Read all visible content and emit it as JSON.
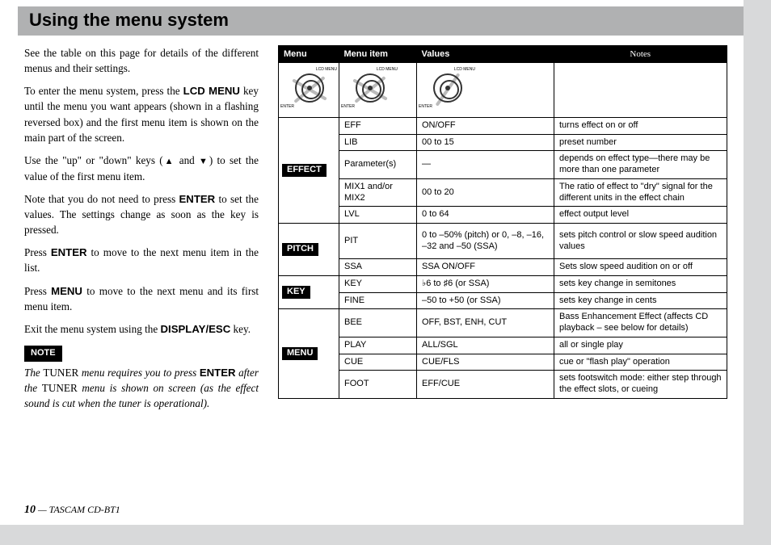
{
  "title": "Using the menu system",
  "footer": {
    "page": "10",
    "sep": " — ",
    "product": "TASCAM CD-BT1"
  },
  "body": {
    "p1": "See the table on this page for details of the different menus and their settings.",
    "p2a": "To enter the menu system, press the ",
    "p2b": "LCD MENU",
    "p2c": " key until the menu you want appears (shown in a flashing reversed box) and the first menu item is shown on the main part of the screen.",
    "p3a": "Use the \"up\" or \"down\" keys (",
    "p3b": "▲",
    "p3c": " and ",
    "p3d": "▼",
    "p3e": ") to set the value of the first menu item.",
    "p4a": "Note that you do not need to press ",
    "p4b": "ENTER",
    "p4c": " to set the values. The settings change as soon as the key is pressed.",
    "p5a": "Press ",
    "p5b": "ENTER",
    "p5c": " to move to the next menu item in the list.",
    "p6a": "Press ",
    "p6b": "MENU",
    "p6c": " to move to the next menu and its first menu item.",
    "p7a": "Exit the menu system using the ",
    "p7b": "DISPLAY/ESC",
    "p7c": " key.",
    "noteLabel": "NOTE",
    "note_a": "The ",
    "note_b": "TUNER",
    "note_c": " menu requires you to press ",
    "note_d": "ENTER",
    "note_e": " after the ",
    "note_f": "TUNER",
    "note_g": " menu is shown on screen (as the effect sound is cut when the tuner is operational)."
  },
  "table": {
    "headers": {
      "menu": "Menu",
      "item": "Menu item",
      "values": "Values",
      "notes": "Notes"
    },
    "iconLabels": {
      "enter": "ENTER",
      "menu": "LCD MENU"
    },
    "groups": [
      {
        "menu": "EFFECT",
        "rows": [
          {
            "item": "EFF",
            "values": "ON/OFF",
            "notes": "turns effect on or off"
          },
          {
            "item": "LIB",
            "values": "00 to 15",
            "notes": "preset number"
          },
          {
            "item": "Parameter(s)",
            "values": "—",
            "notes": "depends on effect type—there may be more than one parameter"
          },
          {
            "item": "MIX1 and/or MIX2",
            "values": "00 to 20",
            "notes": "The ratio of effect to \"dry\" signal for the different units in the effect chain"
          },
          {
            "item": "LVL",
            "values": "0 to 64",
            "notes": "effect output level"
          }
        ]
      },
      {
        "menu": "PITCH",
        "rows": [
          {
            "item": "PIT",
            "values": "0 to –50% (pitch) or 0, –8, –16, –32 and –50 (SSA)",
            "notes": "sets pitch control or slow speed audition values"
          },
          {
            "item": "SSA",
            "values": "SSA ON/OFF",
            "notes": "Sets slow speed audition on or off"
          }
        ]
      },
      {
        "menu": "KEY",
        "rows": [
          {
            "item": "KEY",
            "values": "♭6 to ♯6 (or SSA)",
            "notes": "sets key change in semitones"
          },
          {
            "item": "FINE",
            "values": "–50 to +50 (or SSA)",
            "notes": "sets key change in cents"
          }
        ]
      },
      {
        "menu": "MENU",
        "rows": [
          {
            "item": "BEE",
            "values": "OFF, BST, ENH, CUT",
            "notes": "Bass Enhancement Effect (affects CD playback – see below for details)"
          },
          {
            "item": "PLAY",
            "values": "ALL/SGL",
            "notes": "all or single play"
          },
          {
            "item": "CUE",
            "values": "CUE/FLS",
            "notes": "cue or \"flash play\" operation"
          },
          {
            "item": "FOOT",
            "values": "EFF/CUE",
            "notes": "sets footswitch mode: either step through the effect slots, or cueing"
          }
        ]
      }
    ]
  }
}
